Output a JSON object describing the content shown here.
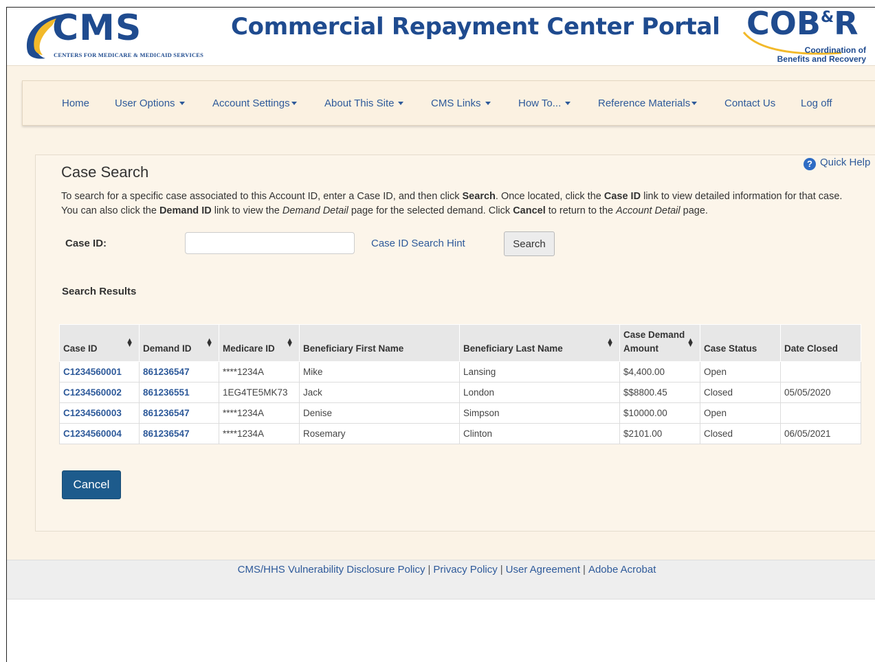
{
  "header": {
    "cms_logo_text": "CMS",
    "cms_logo_subtitle": "CENTERS FOR MEDICARE & MEDICAID SERVICES",
    "portal_title": "Commercial Repayment Center Portal",
    "cob_logo_main": "COB",
    "cob_logo_amp": "&",
    "cob_logo_r": "R",
    "cob_subtitle_line1": "Coordination of",
    "cob_subtitle_line2": "Benefits and Recovery"
  },
  "nav": {
    "home": "Home",
    "user_options": "User Options",
    "account_settings": "Account Settings",
    "about_site": "About This Site",
    "cms_links": "CMS Links",
    "how_to": "How To...",
    "reference_materials": "Reference Materials",
    "contact_us": "Contact Us",
    "log_off": "Log off"
  },
  "page": {
    "title": "Case Search",
    "quick_help": "Quick Help",
    "instructions": {
      "p1": "To search for a specific case associated to this Account ID, enter a Case ID, and then click ",
      "b1": "Search",
      "p2": ". Once located, click the ",
      "b2": "Case ID",
      "p3": " link to view detailed information for that case. You can also click the ",
      "b3": "Demand ID",
      "p4": " link to view the ",
      "i1": "Demand Detail",
      "p5": " page for the selected demand. Click ",
      "b4": "Cancel",
      "p6": " to return to the ",
      "i2": "Account Detail",
      "p7": " page."
    }
  },
  "search": {
    "case_id_label": "Case ID:",
    "case_id_value": "",
    "hint_link": "Case ID Search Hint",
    "search_button": "Search"
  },
  "results": {
    "label": "Search Results",
    "columns": {
      "case_id": "Case ID",
      "demand_id": "Demand ID",
      "medicare_id": "Medicare ID",
      "first_name": "Beneficiary First Name",
      "last_name": "Beneficiary Last Name",
      "demand_amount_line1": "Case Demand",
      "demand_amount_line2": "Amount",
      "case_status": "Case Status",
      "date_closed": "Date Closed"
    },
    "rows": [
      {
        "case_id": "C1234560001",
        "demand_id": "861236547",
        "medicare_id": "****1234A",
        "first_name": "Mike",
        "last_name": "Lansing",
        "amount": "$4,400.00",
        "status": "Open",
        "date_closed": ""
      },
      {
        "case_id": "C1234560002",
        "demand_id": "861236551",
        "medicare_id": "1EG4TE5MK73",
        "first_name": "Jack",
        "last_name": "London",
        "amount": "$$8800.45",
        "status": "Closed",
        "date_closed": "05/05/2020"
      },
      {
        "case_id": "C1234560003",
        "demand_id": "861236547",
        "medicare_id": "****1234A",
        "first_name": "Denise",
        "last_name": "Simpson",
        "amount": "$10000.00",
        "status": "Open",
        "date_closed": ""
      },
      {
        "case_id": "C1234560004",
        "demand_id": "861236547",
        "medicare_id": "****1234A",
        "first_name": "Rosemary",
        "last_name": "Clinton",
        "amount": "$2101.00",
        "status": "Closed",
        "date_closed": "06/05/2021"
      }
    ]
  },
  "actions": {
    "cancel_button": "Cancel"
  },
  "footer": {
    "link1": "CMS/HHS Vulnerability Disclosure Policy",
    "link2": "Privacy Policy",
    "link3": "User Agreement",
    "link4": "Adobe Acrobat",
    "separator": "|"
  },
  "colors": {
    "brand_blue": "#1f4b8f",
    "link_blue": "#2e5a9a",
    "cancel_button": "#1d5b8c",
    "page_background": "#fbf3e6"
  }
}
